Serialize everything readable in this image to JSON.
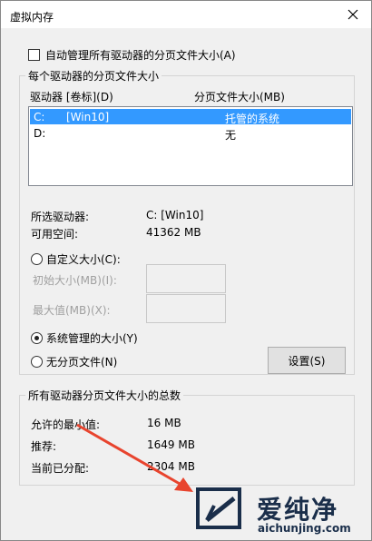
{
  "window": {
    "title": "虚拟内存",
    "close_glyph": "✕"
  },
  "auto_manage": {
    "label": "自动管理所有驱动器的分页文件大小(A)",
    "checked": false
  },
  "drive_group": {
    "legend": "每个驱动器的分页文件大小",
    "col_drive": "驱动器 [卷标](D)",
    "col_size": "分页文件大小(MB)",
    "rows": [
      {
        "drive": "C:",
        "label": "[Win10]",
        "size": "托管的系统",
        "selected": true
      },
      {
        "drive": "D:",
        "label": "",
        "size": "无",
        "selected": false
      }
    ],
    "selected_drive_label": "所选驱动器:",
    "selected_drive_value": "C:  [Win10]",
    "free_space_label": "可用空间:",
    "free_space_value": "41362 MB",
    "custom_size_label": "自定义大小(C):",
    "initial_size_label": "初始大小(MB)(I):",
    "max_size_label": "最大值(MB)(X):",
    "system_managed_label": "系统管理的大小(Y)",
    "no_paging_label": "无分页文件(N)",
    "set_button": "设置(S)",
    "selected_option": "system_managed"
  },
  "totals_group": {
    "legend": "所有驱动器分页文件大小的总数",
    "min_label": "允许的最小值:",
    "min_value": "16 MB",
    "recommended_label": "推荐:",
    "recommended_value": "1649 MB",
    "allocated_label": "当前已分配:",
    "allocated_value": "2304 MB"
  },
  "watermark": {
    "text": "爱纯净",
    "url": "aichunjing.com"
  },
  "colors": {
    "selection": "#3399ff",
    "arrow": "#e8442e",
    "watermark": "#1a2e4a"
  }
}
